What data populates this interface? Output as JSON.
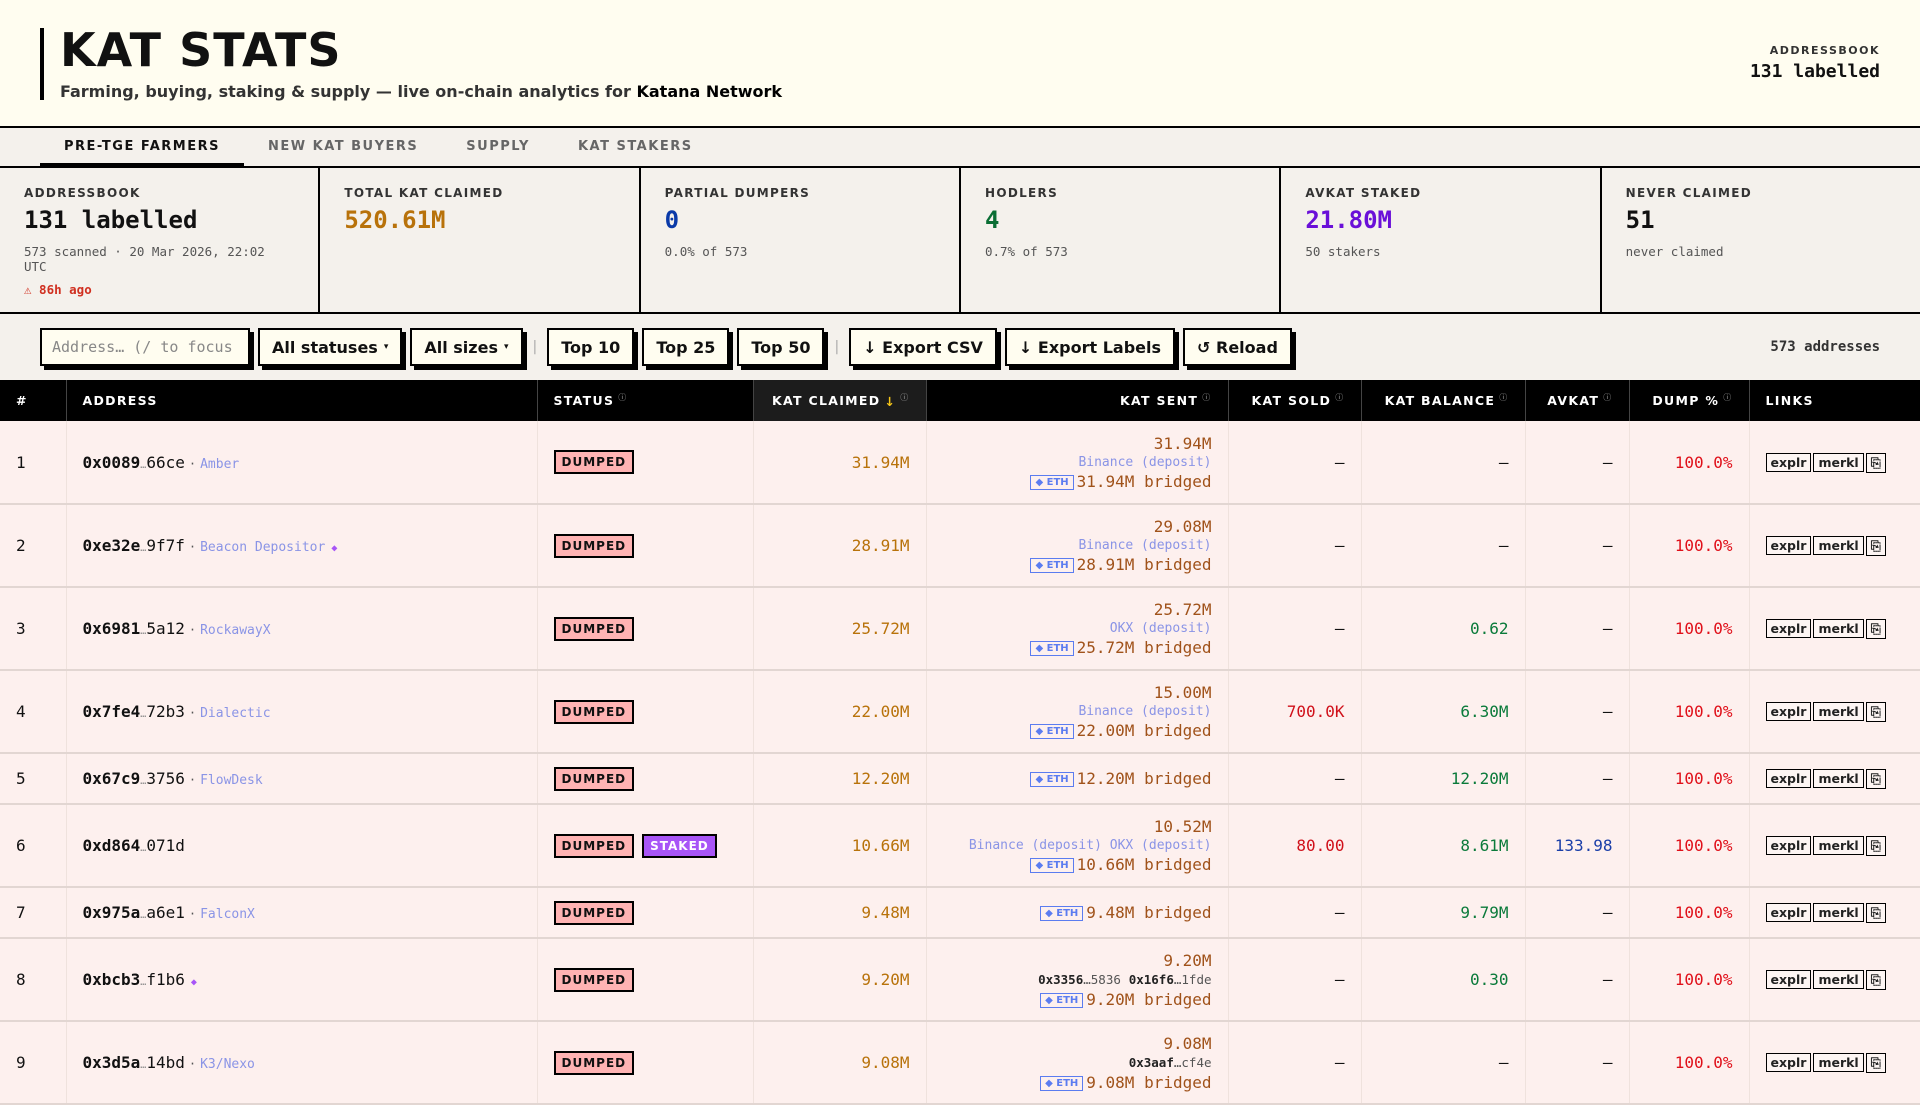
{
  "header": {
    "title": "KAT STATS",
    "subtitle": "Farming, buying, staking & supply — live on-chain analytics for ",
    "subtitle_bold": "Katana Network",
    "addressbook_label": "ADDRESSBOOK",
    "addressbook_value": "131 labelled"
  },
  "tabs": [
    {
      "label": "PRE-TGE FARMERS",
      "active": true
    },
    {
      "label": "NEW KAT BUYERS"
    },
    {
      "label": "SUPPLY"
    },
    {
      "label": "KAT STAKERS"
    }
  ],
  "stats": [
    {
      "label": "ADDRESSBOOK",
      "value": "131 labelled",
      "sub": "573 scanned · 20 Mar 2026, 22:02 UTC",
      "warn": "⚠ 86h ago",
      "color": "#111111"
    },
    {
      "label": "TOTAL KAT CLAIMED",
      "value": "520.61M",
      "color": "#b8720a"
    },
    {
      "label": "PARTIAL DUMPERS",
      "value": "0",
      "sub": "0.0% of 573",
      "color": "#0a3aa8"
    },
    {
      "label": "HODLERS",
      "value": "4",
      "sub": "0.7% of 573",
      "color": "#0a6e34"
    },
    {
      "label": "AVKAT STAKED",
      "value": "21.80M",
      "sub": "50 stakers",
      "color": "#6a10d8"
    },
    {
      "label": "NEVER CLAIMED",
      "value": "51",
      "sub": "never claimed",
      "color": "#111111"
    }
  ],
  "toolbar": {
    "search_placeholder": "Address… (/ to focus",
    "status_select": "All statuses",
    "size_select": "All sizes",
    "top10": "Top 10",
    "top25": "Top 25",
    "top50": "Top 50",
    "export_csv": "↓ Export CSV",
    "export_labels": "↓ Export Labels",
    "reload": "↺ Reload",
    "count": "573 addresses"
  },
  "columns": [
    "#",
    "ADDRESS",
    "STATUS",
    "KAT CLAIMED",
    "KAT SENT",
    "KAT SOLD",
    "KAT BALANCE",
    "AVKAT",
    "DUMP %",
    "LINKS"
  ],
  "sort_arrow": "↓",
  "links": [
    "explr",
    "merkl",
    "⎘"
  ],
  "rows": [
    {
      "n": "1",
      "pre": "0x0089",
      "suf": "66ce",
      "label": "Amber",
      "status": [
        "DUMPED"
      ],
      "claimed": "31.94M",
      "sent": "31.94M",
      "dest": [
        {
          "t": "cex",
          "v": "Binance (deposit)"
        }
      ],
      "bridged": "31.94M bridged",
      "sold": "—",
      "bal": "—",
      "avk": "—",
      "dump": "100.0%"
    },
    {
      "n": "2",
      "pre": "0xe32e",
      "suf": "9f7f",
      "label": "Beacon Depositor",
      "mark": true,
      "status": [
        "DUMPED"
      ],
      "claimed": "28.91M",
      "sent": "29.08M",
      "dest": [
        {
          "t": "cex",
          "v": "Binance (deposit)"
        }
      ],
      "bridged": "28.91M bridged",
      "sold": "—",
      "bal": "—",
      "avk": "—",
      "dump": "100.0%"
    },
    {
      "n": "3",
      "pre": "0x6981",
      "suf": "5a12",
      "label": "RockawayX",
      "status": [
        "DUMPED"
      ],
      "claimed": "25.72M",
      "sent": "25.72M",
      "dest": [
        {
          "t": "cex",
          "v": "OKX (deposit)"
        }
      ],
      "bridged": "25.72M bridged",
      "sold": "—",
      "bal": "0.62",
      "avk": "—",
      "dump": "100.0%"
    },
    {
      "n": "4",
      "pre": "0x7fe4",
      "suf": "72b3",
      "label": "Dialectic",
      "status": [
        "DUMPED"
      ],
      "claimed": "22.00M",
      "sent": "15.00M",
      "dest": [
        {
          "t": "cex",
          "v": "Binance (deposit)"
        }
      ],
      "bridged": "22.00M bridged",
      "sold": "700.0K",
      "bal": "6.30M",
      "avk": "—",
      "dump": "100.0%"
    },
    {
      "n": "5",
      "pre": "0x67c9",
      "suf": "3756",
      "label": "FlowDesk",
      "status": [
        "DUMPED"
      ],
      "claimed": "12.20M",
      "bridged": "12.20M bridged",
      "sold": "—",
      "bal": "12.20M",
      "avk": "—",
      "dump": "100.0%"
    },
    {
      "n": "6",
      "pre": "0xd864",
      "suf": "071d",
      "status": [
        "DUMPED",
        "STAKED"
      ],
      "claimed": "10.66M",
      "sent": "10.52M",
      "dest": [
        {
          "t": "cex",
          "v": "Binance (deposit)"
        },
        {
          "t": "cex",
          "v": "OKX (deposit)"
        }
      ],
      "bridged": "10.66M bridged",
      "sold": "80.00",
      "bal": "8.61M",
      "avk": "133.98",
      "dump": "100.0%"
    },
    {
      "n": "7",
      "pre": "0x975a",
      "suf": "a6e1",
      "label": "FalconX",
      "status": [
        "DUMPED"
      ],
      "claimed": "9.48M",
      "bridged": "9.48M bridged",
      "sold": "—",
      "bal": "9.79M",
      "avk": "—",
      "dump": "100.0%"
    },
    {
      "n": "8",
      "pre": "0xbcb3",
      "suf": "f1b6",
      "mark": true,
      "status": [
        "DUMPED"
      ],
      "claimed": "9.20M",
      "sent": "9.20M",
      "dest": [
        {
          "t": "addr",
          "p": "0x3356",
          "s": "5836"
        },
        {
          "t": "addr",
          "p": "0x16f6",
          "s": "1fde"
        }
      ],
      "bridged": "9.20M bridged",
      "sold": "—",
      "bal": "0.30",
      "avk": "—",
      "dump": "100.0%"
    },
    {
      "n": "9",
      "pre": "0x3d5a",
      "suf": "14bd",
      "label": "K3/Nexo",
      "status": [
        "DUMPED"
      ],
      "claimed": "9.08M",
      "sent": "9.08M",
      "dest": [
        {
          "t": "addr",
          "p": "0x3aaf",
          "s": "cf4e"
        }
      ],
      "bridged": "9.08M bridged",
      "sold": "—",
      "bal": "—",
      "avk": "—",
      "dump": "100.0%"
    }
  ],
  "eth_badge": "◆ ETH",
  "colors": {
    "claimed": "#b8720a",
    "sold": "#d0101a",
    "balance": "#0a7a3a",
    "avkat": "#1a3ea8",
    "dump": "#e0101a",
    "staked": "#a855f7",
    "dumped": "#ffb3b3"
  }
}
